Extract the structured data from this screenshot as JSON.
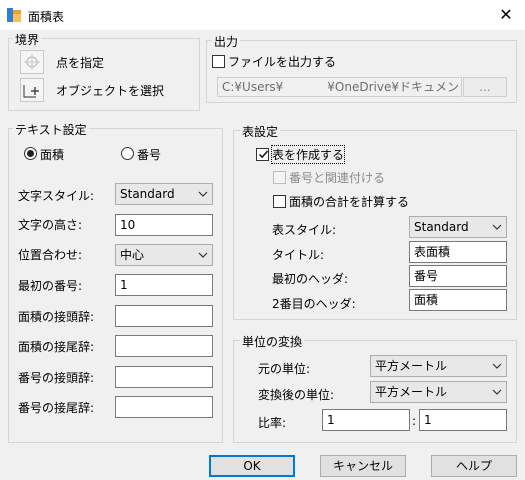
{
  "window": {
    "title": "面積表",
    "close_glyph": "✕"
  },
  "boundary": {
    "legend": "境界",
    "pick_point_label": "点を指定",
    "select_object_label": "オブジェクトを選択"
  },
  "output": {
    "legend": "出力",
    "to_file_label": "ファイルを出力する",
    "to_file_checked": false,
    "path_prefix": "C:¥Users¥",
    "path_suffix": "¥OneDrive¥ドキュメント¥Drawir",
    "browse_label": "..."
  },
  "text_settings": {
    "legend": "テキスト設定",
    "radio_area_label": "面積",
    "radio_number_label": "番号",
    "selected": "area",
    "fields": [
      {
        "label": "文字スタイル:",
        "value": "Standard"
      },
      {
        "label": "文字の高さ:",
        "value": "10"
      },
      {
        "label": "位置合わせ:",
        "value": "中心"
      },
      {
        "label": "最初の番号:",
        "value": "1"
      },
      {
        "label": "面積の接頭辞:",
        "value": ""
      },
      {
        "label": "面積の接尾辞:",
        "value": ""
      },
      {
        "label": "番号の接頭辞:",
        "value": ""
      },
      {
        "label": "番号の接尾辞:",
        "value": ""
      }
    ]
  },
  "table_settings": {
    "legend": "表設定",
    "create_table_label": "表を作成する",
    "create_table_checked": true,
    "link_number_label": "番号と関連付ける",
    "link_number_checked": false,
    "calc_total_label": "面積の合計を計算する",
    "calc_total_checked": false,
    "fields": [
      {
        "label": "表スタイル:",
        "value": "Standard"
      },
      {
        "label": "タイトル:",
        "value": "表面積"
      },
      {
        "label": "最初のヘッダ:",
        "value": "番号"
      },
      {
        "label": "2番目のヘッダ:",
        "value": "面積"
      }
    ]
  },
  "unit_conversion": {
    "legend": "単位の変換",
    "source_unit_label": "元の単位:",
    "source_unit_value": "平方メートル",
    "target_unit_label": "変換後の単位:",
    "target_unit_value": "平方メートル",
    "ratio_label": "比率:",
    "ratio_left": "1",
    "ratio_sep": ":",
    "ratio_right": "1"
  },
  "buttons": {
    "ok": "OK",
    "cancel": "キャンセル",
    "help": "ヘルプ"
  },
  "colors": {
    "accent": "#0078d7",
    "icon_blue": "#2f7fd8",
    "icon_orange": "#f0a030"
  }
}
